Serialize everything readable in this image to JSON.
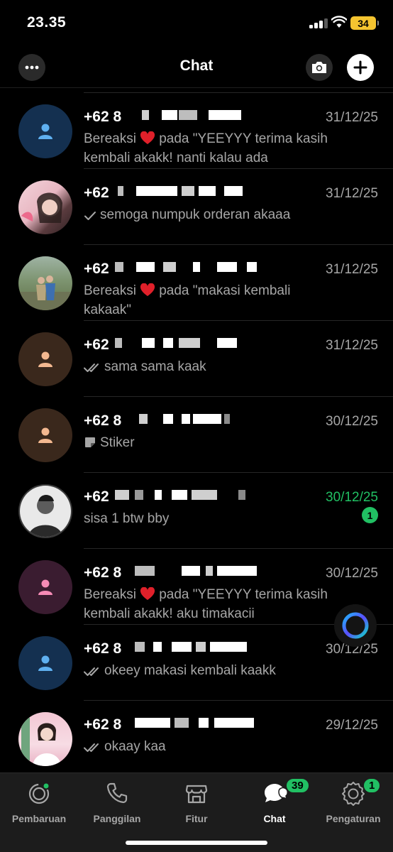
{
  "status_bar": {
    "time": "23.35",
    "battery": "34"
  },
  "header": {
    "title": "Chat"
  },
  "chats": [
    {
      "name_prefix": "+62 8",
      "date": "31/12/25",
      "preview_prefix": "Bereaksi",
      "preview_text": "pada \"YEEYYY terima kasih kembali akakk! nanti kalau ada",
      "avatar": "default-blue"
    },
    {
      "name_prefix": "+62",
      "date": "31/12/25",
      "preview_text": "semoga numpuk orderan akaaa",
      "status": "sent",
      "avatar": "photo-girl"
    },
    {
      "name_prefix": "+62",
      "date": "31/12/25",
      "preview_prefix": "Bereaksi",
      "preview_text": "pada \"makasi kembali kakaak\"",
      "avatar": "photo-couple"
    },
    {
      "name_prefix": "+62",
      "date": "31/12/25",
      "preview_text": "sama sama kaak",
      "status": "delivered",
      "avatar": "default-brown"
    },
    {
      "name_prefix": "+62 8",
      "date": "30/12/25",
      "preview_text": "Stiker",
      "status": "sticker",
      "avatar": "default-brown"
    },
    {
      "name_prefix": "+62",
      "date": "30/12/25",
      "preview_text": "sisa 1 btw bby",
      "unread_count": "1",
      "avatar": "photo-man"
    },
    {
      "name_prefix": "+62 8",
      "date": "30/12/25",
      "preview_prefix": "Bereaksi",
      "preview_text": "pada \"YEEYYY terima kasih kembali akakk! aku timakacii",
      "avatar": "default-pink"
    },
    {
      "name_prefix": "+62 8",
      "date": "30/12/25",
      "preview_text": "okeey makasi kembali kaakk",
      "status": "delivered",
      "avatar": "default-blue"
    },
    {
      "name_prefix": "+62 8",
      "date": "29/12/25",
      "preview_text": "okaay kaa",
      "status": "delivered",
      "avatar": "photo-woman"
    }
  ],
  "bottom_nav": [
    {
      "label": "Pembaruan",
      "icon": "status-icon"
    },
    {
      "label": "Panggilan",
      "icon": "phone-icon"
    },
    {
      "label": "Fitur",
      "icon": "store-icon"
    },
    {
      "label": "Chat",
      "icon": "chat-icon",
      "badge": "39",
      "active": true
    },
    {
      "label": "Pengaturan",
      "icon": "settings-icon",
      "badge": "1"
    }
  ],
  "colors": {
    "accent": "#21c063",
    "background": "#000000",
    "nav_background": "#1c1c1c",
    "secondary_text": "#a6a6a6"
  }
}
